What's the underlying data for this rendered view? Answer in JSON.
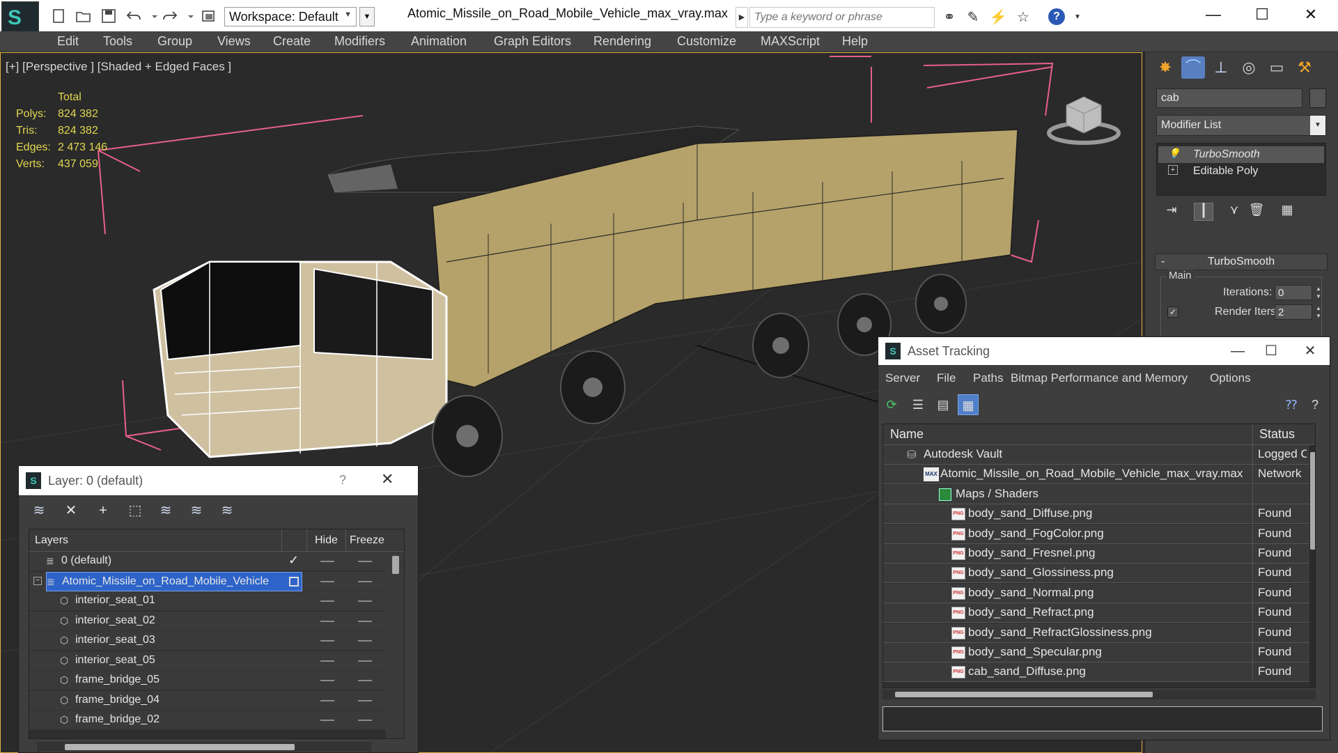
{
  "titlebar": {
    "workspace_label": "Workspace: Default",
    "document_title": "Atomic_Missile_on_Road_Mobile_Vehicle_max_vray.max",
    "search_placeholder": "Type a keyword or phrase",
    "help_label": "?"
  },
  "menubar": {
    "items": [
      "Edit",
      "Tools",
      "Group",
      "Views",
      "Create",
      "Modifiers",
      "Animation",
      "Graph Editors",
      "Rendering",
      "Customize",
      "MAXScript",
      "Help"
    ]
  },
  "viewport": {
    "label": "[+] [Perspective ] [Shaded + Edged Faces ]",
    "stats": {
      "header": "Total",
      "rows": [
        {
          "label": "Polys:",
          "value": "824 382"
        },
        {
          "label": "Tris:",
          "value": "824 382"
        },
        {
          "label": "Edges:",
          "value": "2 473 146"
        },
        {
          "label": "Verts:",
          "value": "437 059"
        }
      ]
    }
  },
  "command_panel": {
    "object_name": "cab",
    "modifier_list": "Modifier List",
    "stack": [
      "TurboSmooth",
      "Editable Poly"
    ],
    "rollout_title": "TurboSmooth",
    "group_label": "Main",
    "iterations_label": "Iterations:",
    "iterations_value": "0",
    "render_iters_label": "Render Iters:",
    "render_iters_value": "2",
    "render_iters_checked": true
  },
  "asset_tracking": {
    "title": "Asset Tracking",
    "menu": [
      "Server",
      "File",
      "Paths",
      "Bitmap Performance and Memory",
      "Options"
    ],
    "columns": {
      "name": "Name",
      "status": "Status"
    },
    "rows": [
      {
        "name": "Autodesk Vault",
        "status": "Logged O",
        "icon": "vault-icon",
        "indent": 1
      },
      {
        "name": "Atomic_Missile_on_Road_Mobile_Vehicle_max_vray.max",
        "status": "Network",
        "icon": "max-file-icon",
        "indent": 2
      },
      {
        "name": "Maps / Shaders",
        "status": "",
        "icon": "maps-icon",
        "indent": 3
      },
      {
        "name": "body_sand_Diffuse.png",
        "status": "Found",
        "icon": "png-icon",
        "indent": 4
      },
      {
        "name": "body_sand_FogColor.png",
        "status": "Found",
        "icon": "png-icon",
        "indent": 4
      },
      {
        "name": "body_sand_Fresnel.png",
        "status": "Found",
        "icon": "png-icon",
        "indent": 4
      },
      {
        "name": "body_sand_Glossiness.png",
        "status": "Found",
        "icon": "png-icon",
        "indent": 4
      },
      {
        "name": "body_sand_Normal.png",
        "status": "Found",
        "icon": "png-icon",
        "indent": 4
      },
      {
        "name": "body_sand_Refract.png",
        "status": "Found",
        "icon": "png-icon",
        "indent": 4
      },
      {
        "name": "body_sand_RefractGlossiness.png",
        "status": "Found",
        "icon": "png-icon",
        "indent": 4
      },
      {
        "name": "body_sand_Specular.png",
        "status": "Found",
        "icon": "png-icon",
        "indent": 4
      },
      {
        "name": "cab_sand_Diffuse.png",
        "status": "Found",
        "icon": "png-icon",
        "indent": 4
      }
    ]
  },
  "layer_window": {
    "title": "Layer: 0 (default)",
    "help": "?",
    "columns": {
      "layers": "Layers",
      "hide": "Hide",
      "freeze": "Freeze"
    },
    "rows": [
      {
        "name": "0 (default)",
        "type": "layer",
        "current": true
      },
      {
        "name": "Atomic_Missile_on_Road_Mobile_Vehicle",
        "type": "layer",
        "selected": true
      },
      {
        "name": "interior_seat_01",
        "type": "object"
      },
      {
        "name": "interior_seat_02",
        "type": "object"
      },
      {
        "name": "interior_seat_03",
        "type": "object"
      },
      {
        "name": "interior_seat_05",
        "type": "object"
      },
      {
        "name": "frame_bridge_05",
        "type": "object"
      },
      {
        "name": "frame_bridge_04",
        "type": "object"
      },
      {
        "name": "frame_bridge_02",
        "type": "object"
      }
    ]
  },
  "colors": {
    "stats_yellow": "#e2d64f",
    "selection_blue": "#2e64c9",
    "vehicle_sand": "#c8b47a",
    "bbox_pink": "#e8608a"
  }
}
